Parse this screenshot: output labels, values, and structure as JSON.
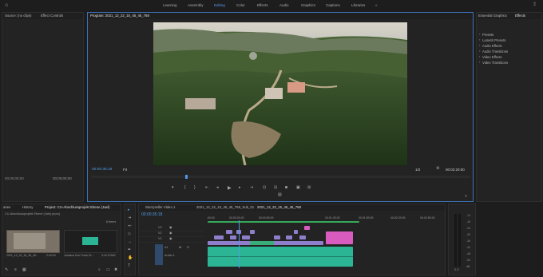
{
  "top_nav": [
    "Learning",
    "Assembly",
    "Editing",
    "Color",
    "Effects",
    "Audio",
    "Graphics",
    "Captions",
    "Libraries"
  ],
  "top_nav_active": "Editing",
  "source_panel": {
    "tab1": "Source: (no clips)",
    "tab2": "Effect Controls",
    "timecode": "00;00;00;00",
    "timecode2": "00;00;00;00"
  },
  "program": {
    "title": "Program: 2021_12_22_15_45_45_768",
    "timecode": "00:00:35:18",
    "fit": "Fit",
    "ratio": "1/2",
    "duration": "00:02:20:00"
  },
  "effects_panel": {
    "tab1": "Essential Graphics",
    "tab2": "Effects",
    "items": [
      "Presets",
      "Lumetri Presets",
      "Audio Effects",
      "Audio Transitions",
      "Video Effects",
      "Video Transitions"
    ]
  },
  "project_panel": {
    "tabs": [
      "aries",
      "History",
      "Project: CU-Abschlussprojekt Ebene (Jael)"
    ],
    "subtitle": "CU-Abschlussprojekt Ebene (Jael).prproj",
    "count": "8 items",
    "clips": [
      {
        "name": "2021_12_22_15_45_45...",
        "dur": "2:20:00"
      },
      {
        "name": "Jamaica Dub Track 01...",
        "dur": "3:16.97660"
      }
    ]
  },
  "timeline": {
    "tabs": [
      "Storryseller Video 1",
      "2021_12_22_15_45_45_768_Sub_01",
      "2021_12_22_15_45_45_768"
    ],
    "timecode": "00:00:35:18",
    "ruler": [
      ":00:00",
      "00:00:29:29",
      "00:00:59:29",
      "00:01:29:29",
      "00:01:59:29",
      "00:02:29:29",
      "00:02:59:29"
    ],
    "tracks": [
      "V3",
      "V2",
      "V1",
      "A1"
    ],
    "audio_label": "Audio 1"
  },
  "meter": {
    "labels": [
      "-12",
      "-18",
      "-24",
      "-30",
      "-36",
      "-42",
      "-48",
      "-54",
      "dB"
    ],
    "solo": "S S"
  },
  "colors": {
    "accent": "#3d72b8",
    "video_clip": "#8f7ecb",
    "audio_clip": "#2bb595",
    "pink_clip": "#d85cc0",
    "playhead": "#4e9ae6"
  }
}
